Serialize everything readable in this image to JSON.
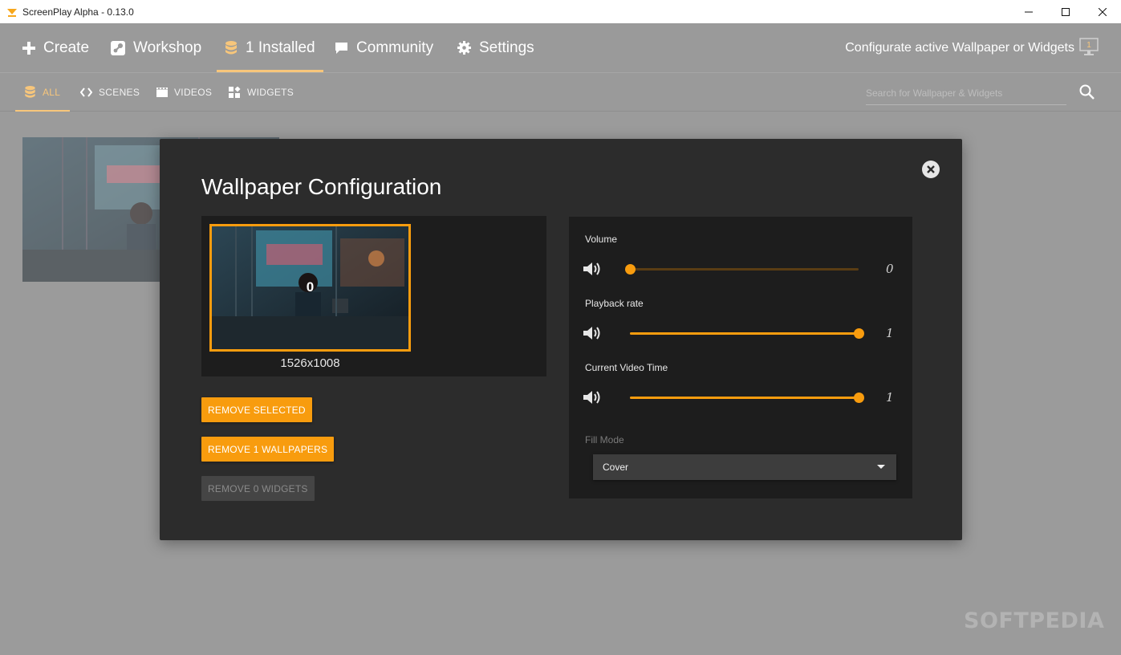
{
  "window": {
    "title": "ScreenPlay Alpha - 0.13.0",
    "controls": {
      "minimize": "—",
      "maximize": "☐",
      "close": "✕"
    }
  },
  "nav": {
    "items": [
      {
        "label": "Create",
        "icon": "plus-icon"
      },
      {
        "label": "Workshop",
        "icon": "steam-icon"
      },
      {
        "label": "1 Installed",
        "icon": "database-icon",
        "active": true
      },
      {
        "label": "Community",
        "icon": "chat-icon"
      },
      {
        "label": "Settings",
        "icon": "gear-icon"
      }
    ],
    "configurate_label": "Configurate active Wallpaper or Widgets",
    "monitor_badge": "1"
  },
  "subnav": {
    "items": [
      {
        "label": "ALL",
        "icon": "database-icon",
        "active": true
      },
      {
        "label": "SCENES",
        "icon": "code-icon"
      },
      {
        "label": "VIDEOS",
        "icon": "film-icon"
      },
      {
        "label": "WIDGETS",
        "icon": "widgets-icon"
      }
    ],
    "search_placeholder": "Search for Wallpaper & Widgets"
  },
  "modal": {
    "title": "Wallpaper Configuration",
    "preview": {
      "index": "0",
      "resolution": "1526x1008"
    },
    "buttons": {
      "remove_selected": "REMOVE SELECTED",
      "remove_wallpapers": "REMOVE 1 WALLPAPERS",
      "remove_widgets": "REMOVE 0 WIDGETS"
    },
    "settings": {
      "volume": {
        "label": "Volume",
        "value": "0",
        "fraction": 0.0
      },
      "playback_rate": {
        "label": "Playback rate",
        "value": "1",
        "fraction": 1.0
      },
      "video_time": {
        "label": "Current Video Time",
        "value": "1",
        "fraction": 1.0
      },
      "fill_mode": {
        "label": "Fill Mode",
        "value": "Cover"
      }
    }
  },
  "colors": {
    "accent": "#f89c0e",
    "modal_bg": "#2c2c2c",
    "panel_bg": "#1d1d1d",
    "nav_bg": "#9a9a9a"
  },
  "watermark": "SOFTPEDIA"
}
